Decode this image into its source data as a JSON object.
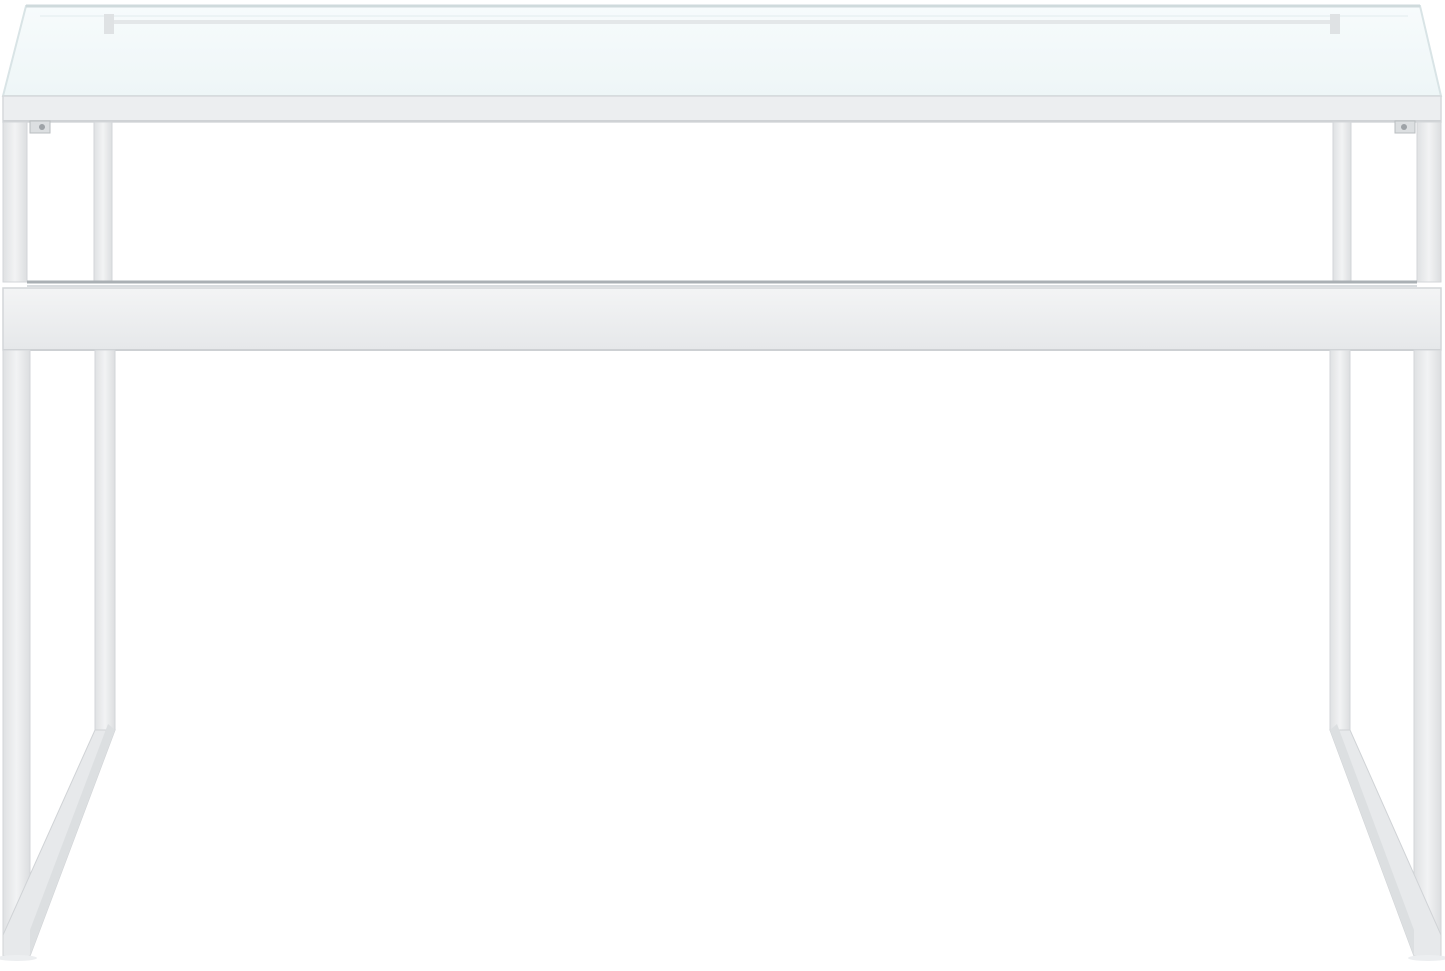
{
  "image": {
    "subject": "glass-top-desk",
    "background_color": "#ffffff",
    "frame_color": "#e9eaec",
    "frame_shadow_color": "#cfd1d4",
    "glass_color": "#f4fbfb",
    "glass_edge_color": "#d9e4e6",
    "shelf_edge_color": "#aab0b4"
  }
}
